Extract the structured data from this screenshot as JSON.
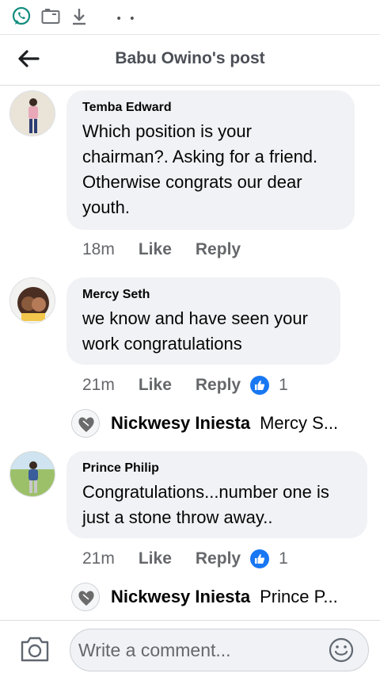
{
  "status_bar": {
    "icons": [
      "whatsapp-icon",
      "screen-cast-icon",
      "download-icon"
    ],
    "dots": "• •"
  },
  "header": {
    "title": "Babu Owino's post",
    "back_icon": "back-arrow-icon"
  },
  "comments": [
    {
      "author": "Temba Edward",
      "text": "Which position is your chairman?. Asking for a friend. Otherwise congrats our dear youth.",
      "time": "18m",
      "like_label": "Like",
      "reply_label": "Reply"
    },
    {
      "author": "Mercy Seth",
      "text": "we know and have seen your work congratulations",
      "time": "21m",
      "like_label": "Like",
      "reply_label": "Reply",
      "reaction_count": "1",
      "reply_preview": {
        "author": "Nickwesy Iniesta",
        "text": "Mercy S..."
      }
    },
    {
      "author": "Prince Philip",
      "text": "Congratulations...number one is just a stone throw away..",
      "time": "21m",
      "like_label": "Like",
      "reply_label": "Reply",
      "reaction_count": "1",
      "reply_preview": {
        "author": "Nickwesy Iniesta",
        "text": "Prince P..."
      }
    }
  ],
  "footer": {
    "placeholder": "Write a comment...",
    "camera_icon": "camera-icon",
    "emoji_icon": "emoji-icon"
  },
  "colors": {
    "bubble": "#f0f2f5",
    "meta_text": "#65676b",
    "like_blue": "#1877f2",
    "whatsapp_green": "#128c7e"
  }
}
